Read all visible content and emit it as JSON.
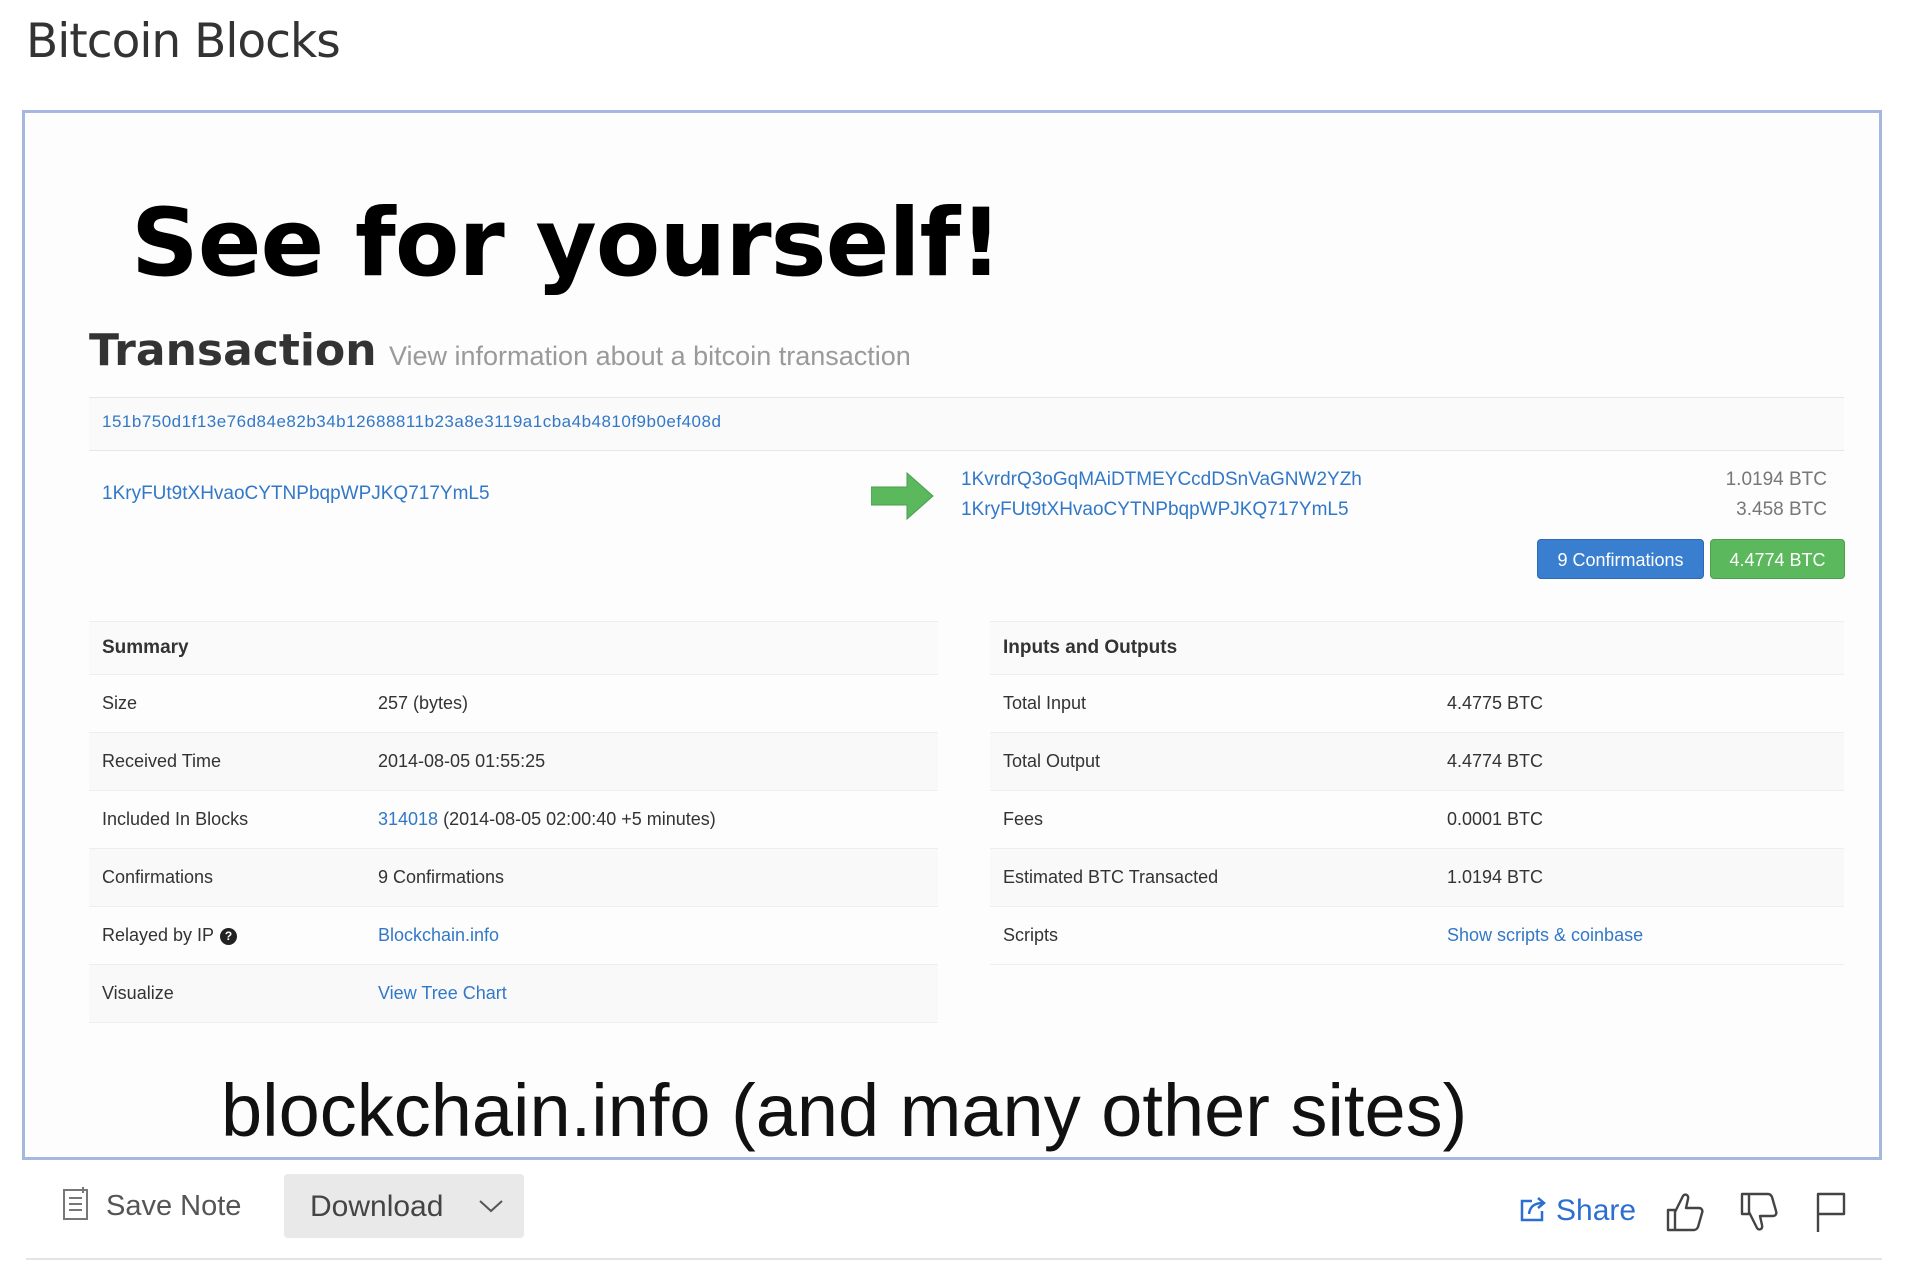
{
  "page": {
    "title": "Bitcoin Blocks"
  },
  "slide": {
    "headline": "See for yourself!",
    "caption": "blockchain.info (and many other sites)"
  },
  "transaction": {
    "title": "Transaction",
    "subtitle": "View information about a bitcoin transaction",
    "hash": "151b750d1f13e76d84e82b34b12688811b23a8e3119a1cba4b4810f9b0ef408d",
    "from_address": "1KryFUt9tXHvaoCYTNPbqpWPJKQ717YmL5",
    "outputs": [
      {
        "address": "1KvrdrQ3oGqMAiDTMEYCcdDSnVaGNW2YZh",
        "amount": "1.0194 BTC"
      },
      {
        "address": "1KryFUt9tXHvaoCYTNPbqpWPJKQ717YmL5",
        "amount": "3.458 BTC"
      }
    ],
    "confirmations_badge": "9 Confirmations",
    "total_badge": "4.4774 BTC"
  },
  "summary": {
    "title": "Summary",
    "size_label": "Size",
    "size_value": "257 (bytes)",
    "received_label": "Received Time",
    "received_value": "2014-08-05 01:55:25",
    "blocks_label": "Included In Blocks",
    "block_link": "314018",
    "block_rest": " (2014-08-05 02:00:40 +5 minutes)",
    "confirmations_label": "Confirmations",
    "confirmations_value": "9 Confirmations",
    "relayed_label": "Relayed by IP",
    "relayed_help": "?",
    "relayed_value": "Blockchain.info",
    "visualize_label": "Visualize",
    "visualize_value": "View Tree Chart"
  },
  "io": {
    "title": "Inputs and Outputs",
    "total_input_label": "Total Input",
    "total_input_value": "4.4775 BTC",
    "total_output_label": "Total Output",
    "total_output_value": "4.4774 BTC",
    "fees_label": "Fees",
    "fees_value": "0.0001 BTC",
    "estimated_label": "Estimated BTC Transacted",
    "estimated_value": "1.0194 BTC",
    "scripts_label": "Scripts",
    "scripts_value": "Show scripts & coinbase"
  },
  "toolbar": {
    "save_note_label": "Save Note",
    "download_label": "Download",
    "share_label": "Share",
    "icons": [
      "note-icon",
      "chevron-down-icon",
      "share-icon",
      "thumbs-up-icon",
      "thumbs-down-icon",
      "flag-icon"
    ]
  },
  "colors": {
    "link": "#3278c8",
    "confirm_badge": "#3a7fcf",
    "total_badge": "#5cb85c",
    "arrow": "#5cb85c",
    "share": "#2d6fd1",
    "slide_border": "#a7b8e0"
  }
}
